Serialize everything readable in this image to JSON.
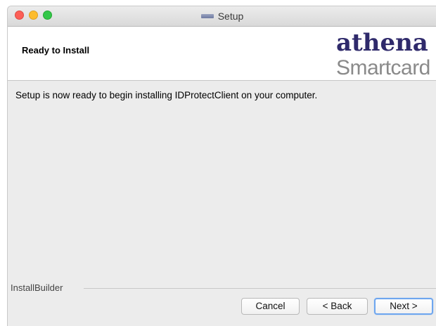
{
  "window": {
    "title": "Setup",
    "controls": [
      "close",
      "minimize",
      "maximize"
    ]
  },
  "banner": {
    "title": "Ready to Install",
    "logo": {
      "line1": "athena",
      "line2": "Smartcard"
    }
  },
  "content": {
    "message": "Setup is now ready to begin installing IDProtectClient on your computer."
  },
  "footer": {
    "brand": "InstallBuilder",
    "buttons": {
      "cancel": "Cancel",
      "back": "< Back",
      "next": "Next >"
    }
  },
  "colors": {
    "close": "#fc5f57",
    "minimize": "#fdbc2e",
    "maximize": "#33c748",
    "logo_primary": "#2f2a6b",
    "logo_secondary": "#8a8a8a",
    "focus_ring": "#6ea6ef"
  }
}
